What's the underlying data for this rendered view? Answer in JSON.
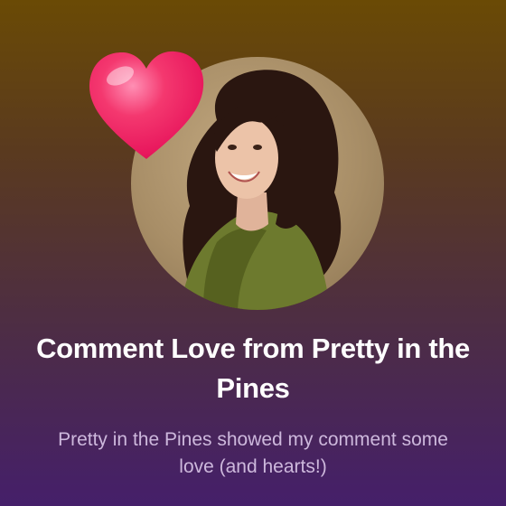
{
  "notification": {
    "title": "Comment Love from Pretty in the Pines",
    "message": "Pretty in the Pines showed my comment some love (and hearts!)"
  },
  "icons": {
    "reaction": "heart-icon",
    "profile": "profile-photo"
  },
  "colors": {
    "background_top": "#6a4a05",
    "background_bottom": "#451f6a",
    "heart": "#e8175d",
    "title_text": "#ffffff",
    "message_text": "#cdb8dc"
  }
}
